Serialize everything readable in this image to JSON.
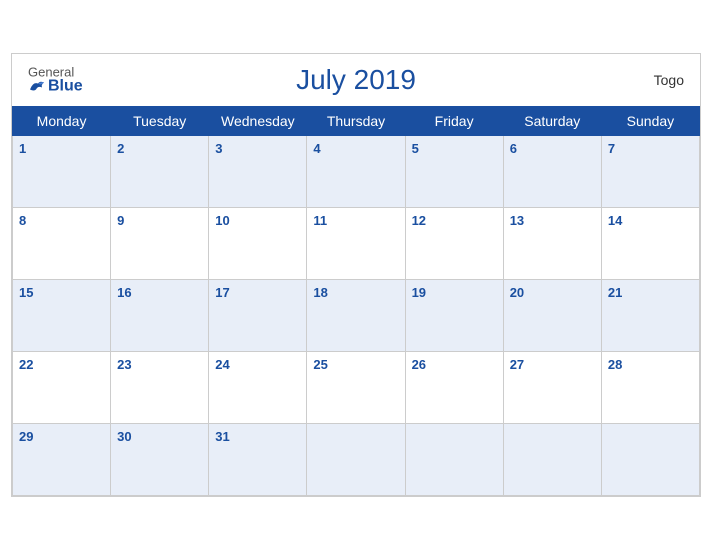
{
  "header": {
    "logo_general": "General",
    "logo_blue": "Blue",
    "title": "July 2019",
    "country": "Togo"
  },
  "weekdays": [
    "Monday",
    "Tuesday",
    "Wednesday",
    "Thursday",
    "Friday",
    "Saturday",
    "Sunday"
  ],
  "weeks": [
    [
      {
        "day": 1
      },
      {
        "day": 2
      },
      {
        "day": 3
      },
      {
        "day": 4
      },
      {
        "day": 5
      },
      {
        "day": 6
      },
      {
        "day": 7
      }
    ],
    [
      {
        "day": 8
      },
      {
        "day": 9
      },
      {
        "day": 10
      },
      {
        "day": 11
      },
      {
        "day": 12
      },
      {
        "day": 13
      },
      {
        "day": 14
      }
    ],
    [
      {
        "day": 15
      },
      {
        "day": 16
      },
      {
        "day": 17
      },
      {
        "day": 18
      },
      {
        "day": 19
      },
      {
        "day": 20
      },
      {
        "day": 21
      }
    ],
    [
      {
        "day": 22
      },
      {
        "day": 23
      },
      {
        "day": 24
      },
      {
        "day": 25
      },
      {
        "day": 26
      },
      {
        "day": 27
      },
      {
        "day": 28
      }
    ],
    [
      {
        "day": 29
      },
      {
        "day": 30
      },
      {
        "day": 31
      },
      {
        "day": null
      },
      {
        "day": null
      },
      {
        "day": null
      },
      {
        "day": null
      }
    ]
  ]
}
